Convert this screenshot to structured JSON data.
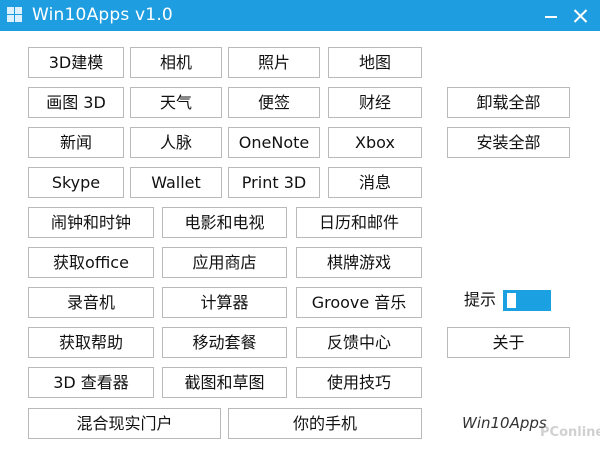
{
  "window": {
    "title": "Win10Apps v1.0"
  },
  "buttons": {
    "3d_builder": "3D建模",
    "camera": "相机",
    "photos": "照片",
    "maps": "地图",
    "paint3d": "画图 3D",
    "weather": "天气",
    "sticky_notes": "便签",
    "money": "财经",
    "uninstall_all": "卸载全部",
    "news": "新闻",
    "people": "人脉",
    "onenote": "OneNote",
    "xbox": "Xbox",
    "install_all": "安装全部",
    "skype": "Skype",
    "wallet": "Wallet",
    "print3d": "Print 3D",
    "messaging": "消息",
    "alarms": "闹钟和时钟",
    "movies_tv": "电影和电视",
    "calendar_mail": "日历和邮件",
    "get_office": "获取office",
    "store": "应用商店",
    "board_games": "棋牌游戏",
    "voice_recorder": "录音机",
    "calculator": "计算器",
    "groove": "Groove 音乐",
    "get_help": "获取帮助",
    "mobile_plans": "移动套餐",
    "feedback_hub": "反馈中心",
    "about": "关于",
    "3d_viewer": "3D 查看器",
    "snip_sketch": "截图和草图",
    "tips": "使用技巧",
    "mixed_reality": "混合现实门户",
    "your_phone": "你的手机"
  },
  "hint": {
    "label": "提示"
  },
  "footer": {
    "brand": "Win10Apps",
    "watermark": "PConline"
  },
  "colors": {
    "titlebar": "#1e9de0",
    "toggle": "#1ba1e2",
    "button_border": "#b9b9b9"
  },
  "icons": {
    "app_icon": "windows-logo-icon",
    "minimize": "minimize-icon",
    "close": "close-icon"
  }
}
